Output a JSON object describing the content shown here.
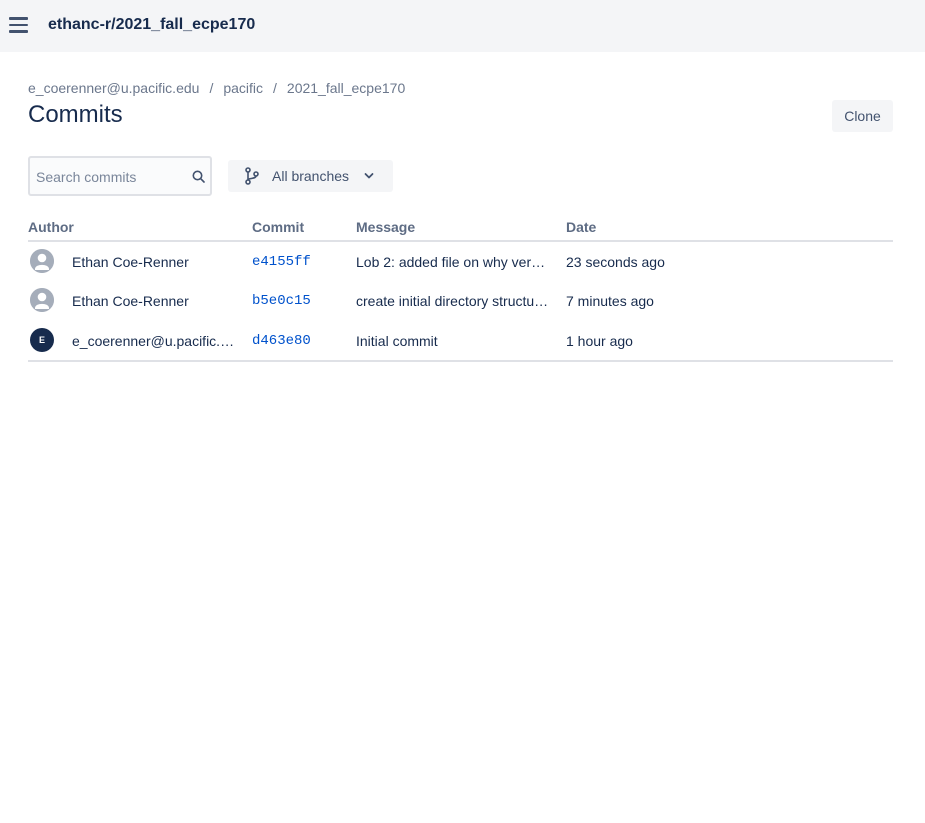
{
  "header": {
    "repo_title": "ethanc-r/2021_fall_ecpe170"
  },
  "breadcrumb": {
    "items": [
      "e_coerenner@u.pacific.edu",
      "pacific",
      "2021_fall_ecpe170"
    ],
    "separator": "/"
  },
  "page": {
    "title": "Commits",
    "clone_label": "Clone"
  },
  "search": {
    "placeholder": "Search commits",
    "value": ""
  },
  "branch_filter": {
    "label": "All branches"
  },
  "table": {
    "columns": [
      "Author",
      "Commit",
      "Message",
      "Date"
    ],
    "rows": [
      {
        "avatar": "default-user-icon",
        "author": "Ethan Coe-Renner",
        "commit": "e4155ff",
        "message": "Lob 2: added file on why ver…",
        "date": "23 seconds ago"
      },
      {
        "avatar": "default-user-icon",
        "author": "Ethan Coe-Renner",
        "commit": "b5e0c15",
        "message": "create initial directory structu…",
        "date": "7 minutes ago"
      },
      {
        "avatar": "E",
        "author": "e_coerenner@u.pacific.…",
        "commit": "d463e80",
        "message": "Initial commit",
        "date": "1 hour ago"
      }
    ]
  },
  "colors": {
    "topbar_bg": "#f4f5f7",
    "link": "#0052cc",
    "text": "#172b4d",
    "muted": "#6b778c",
    "avatar_dark": "#172b4d"
  }
}
